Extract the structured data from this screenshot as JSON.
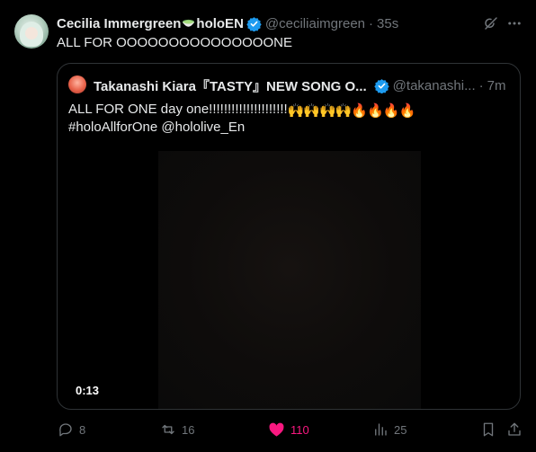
{
  "tweet": {
    "author_name": "Cecilia Immergreen",
    "author_suffix": "holoEN",
    "handle": "@ceciliaimgreen",
    "separator": "·",
    "time": "35s",
    "text": "ALL FOR OOOOOOOOOOOOOOONE"
  },
  "quoted": {
    "author_name": "Takanashi Kiara『TASTY』NEW SONG O...",
    "handle": "@takanashi...",
    "separator": "·",
    "time": "7m",
    "text_line1": "ALL FOR ONE day one!!!!!!!!!!!!!!!!!!!!!",
    "text_line1_emojis": "🙌🙌🙌🙌🔥🔥🔥🔥",
    "text_line2": "#holoAllforOne @hololive_En",
    "video_duration": "0:13"
  },
  "actions": {
    "replies": "8",
    "reposts": "16",
    "likes": "110",
    "views": "25"
  },
  "colors": {
    "background": "#000000",
    "text": "#e7e9ea",
    "muted": "#71767b",
    "verified": "#1d9bf0",
    "like": "#f91880",
    "border": "#2f3336"
  }
}
